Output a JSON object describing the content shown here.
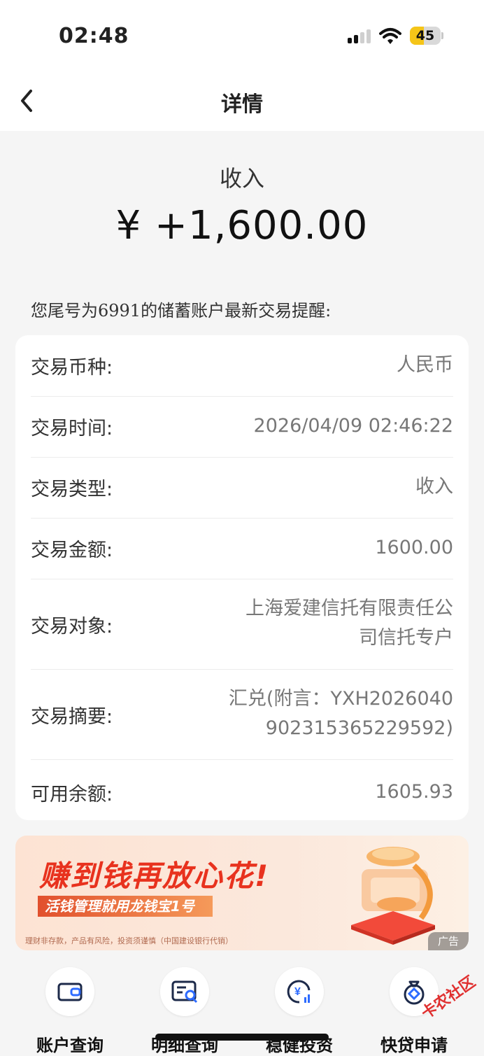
{
  "status_bar": {
    "time": "02:48",
    "battery": "45",
    "battery_level": 0.45
  },
  "nav": {
    "title": "详情",
    "back_icon": "chevron-left-icon"
  },
  "summary": {
    "label": "收入",
    "amount": "¥ +1,600.00"
  },
  "notice": "您尾号为6991的储蓄账户最新交易提醒:",
  "details": [
    {
      "key": "交易币种:",
      "value": "人民币"
    },
    {
      "key": "交易时间:",
      "value": "2026/04/09 02:46:22"
    },
    {
      "key": "交易类型:",
      "value": "收入"
    },
    {
      "key": "交易金额:",
      "value": "1600.00"
    },
    {
      "key": "交易对象:",
      "value_lines": [
        "上海爱建信托有限责任公",
        "司信托专户"
      ]
    },
    {
      "key": "交易摘要:",
      "value_lines": [
        "汇兑(附言：YXH2026040",
        "902315365229592)"
      ]
    },
    {
      "key": "可用余额:",
      "value": "1605.93"
    }
  ],
  "banner": {
    "title": "赚到钱再放心花!",
    "subtitle": "活钱管理就用龙钱宝1号",
    "fine_print": "理财非存款，产品有风险，投资须谨慎（中国建设银行代销）",
    "ad_tag": "广告"
  },
  "quick_actions": [
    {
      "label": "账户查询",
      "icon": "wallet-icon"
    },
    {
      "label": "明细查询",
      "icon": "search-list-icon"
    },
    {
      "label": "稳健投资",
      "icon": "yuan-chart-icon"
    },
    {
      "label": "快贷申请",
      "icon": "money-bag-icon"
    }
  ],
  "watermark": "卡农社区",
  "colors": {
    "accent_red": "#e8321e",
    "battery_yellow": "#f5c518"
  }
}
